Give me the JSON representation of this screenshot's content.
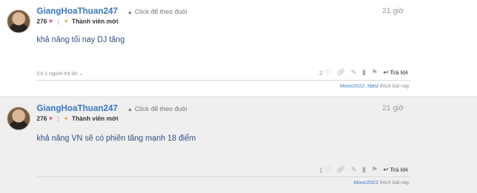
{
  "posts": [
    {
      "username": "GiangHoaThuan247",
      "follow_label": "Click để theo đuôi",
      "points": "276",
      "rank": "Thành viên mới",
      "time": "21 giờ",
      "content": "khả năng tối nay DJ tăng",
      "replies": "Có 1 người trả lời",
      "like_count": "2",
      "reply_label": "Trả lời",
      "likers": "Moon2022, hbtsl",
      "likers_suffix": "thích bài này"
    },
    {
      "username": "GiangHoaThuan247",
      "follow_label": "Click để theo đuôi",
      "points": "276",
      "rank": "Thành viên mới",
      "time": "21 giờ",
      "content": "khả năng VN sẽ có phiên tăng mạnh 18 điểm",
      "like_count": "1",
      "reply_label": "Trả lời",
      "likers": "Moon2022",
      "likers_suffix": "thích bài này"
    }
  ],
  "icons": [
    "heart-icon",
    "link-icon",
    "edit-icon",
    "bookmark-icon",
    "flag-icon",
    "reply-arrow-icon",
    "chevron-down-icon",
    "rank-badge-icon",
    "follow-icon"
  ],
  "colors": {
    "username": "#3a78c2",
    "content": "#2e4d80",
    "heart": "#e06a8a",
    "post2_bg": "#efeff0"
  }
}
